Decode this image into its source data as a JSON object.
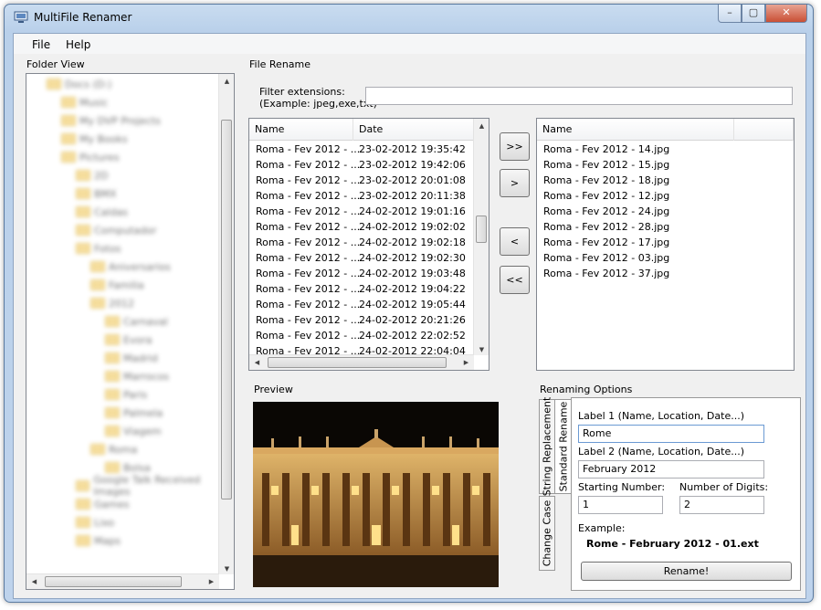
{
  "window": {
    "title": "MultiFile Renamer"
  },
  "menu": [
    "File",
    "Help"
  ],
  "folder_view": {
    "label": "Folder View",
    "tree": [
      "Docs (D:)",
      "Music",
      "My DVP Projects",
      "My Books",
      "Pictures",
      "2D",
      "BMX",
      "Caldas",
      "Computador",
      "Fotos",
      "Aniversarios",
      "Familia",
      "2012",
      "Carnaval",
      "Evora",
      "Madrid",
      "Marrocos",
      "Paris",
      "Palmela",
      "Viagem",
      "Roma",
      "Bolsa",
      "Google Talk Received Images",
      "Games",
      "Lixo",
      "Maps"
    ]
  },
  "file_rename": {
    "label": "File Rename",
    "filter_label_1": "Filter extensions:",
    "filter_label_2": "(Example: jpeg,exe,txt)",
    "filter_value": "",
    "source": {
      "headers": [
        "Name",
        "Date"
      ],
      "rows": [
        [
          "Roma - Fev 2012 - ...",
          "23-02-2012 19:35:42"
        ],
        [
          "Roma - Fev 2012 - ...",
          "23-02-2012 19:42:06"
        ],
        [
          "Roma - Fev 2012 - ...",
          "23-02-2012 20:01:08"
        ],
        [
          "Roma - Fev 2012 - ...",
          "23-02-2012 20:11:38"
        ],
        [
          "Roma - Fev 2012 - ...",
          "24-02-2012 19:01:16"
        ],
        [
          "Roma - Fev 2012 - ...",
          "24-02-2012 19:02:02"
        ],
        [
          "Roma - Fev 2012 - ...",
          "24-02-2012 19:02:18"
        ],
        [
          "Roma - Fev 2012 - ...",
          "24-02-2012 19:02:30"
        ],
        [
          "Roma - Fev 2012 - ...",
          "24-02-2012 19:03:48"
        ],
        [
          "Roma - Fev 2012 - ...",
          "24-02-2012 19:04:22"
        ],
        [
          "Roma - Fev 2012 - ...",
          "24-02-2012 19:05:44"
        ],
        [
          "Roma - Fev 2012 - ...",
          "24-02-2012 20:21:26"
        ],
        [
          "Roma - Fev 2012 - ...",
          "24-02-2012 22:02:52"
        ],
        [
          "Roma - Fev 2012 - ...",
          "24-02-2012 22:04:04"
        ]
      ]
    },
    "buttons": {
      "add_all": ">>",
      "add": ">",
      "remove": "<",
      "remove_all": "<<"
    },
    "target": {
      "header": "Name",
      "rows": [
        "Roma - Fev 2012 - 14.jpg",
        "Roma - Fev 2012 - 15.jpg",
        "Roma - Fev 2012 - 18.jpg",
        "Roma - Fev 2012 - 12.jpg",
        "Roma - Fev 2012 - 24.jpg",
        "Roma - Fev 2012 - 28.jpg",
        "Roma - Fev 2012 - 17.jpg",
        "Roma - Fev 2012 - 03.jpg",
        "Roma - Fev 2012 - 37.jpg"
      ]
    }
  },
  "preview": {
    "label": "Preview"
  },
  "options": {
    "label": "Renaming Options",
    "tabs": [
      "Standard Rename",
      "String Replacement",
      "Change Case"
    ],
    "label1_caption": "Label 1 (Name, Location, Date...)",
    "label1_value": "Rome",
    "label2_caption": "Label 2 (Name, Location, Date...)",
    "label2_value": "February 2012",
    "start_caption": "Starting Number:",
    "start_value": "1",
    "digits_caption": "Number of Digits:",
    "digits_value": "2",
    "example_caption": "Example:",
    "example_value": "Rome - February 2012 - 01.ext",
    "rename_button": "Rename!"
  }
}
